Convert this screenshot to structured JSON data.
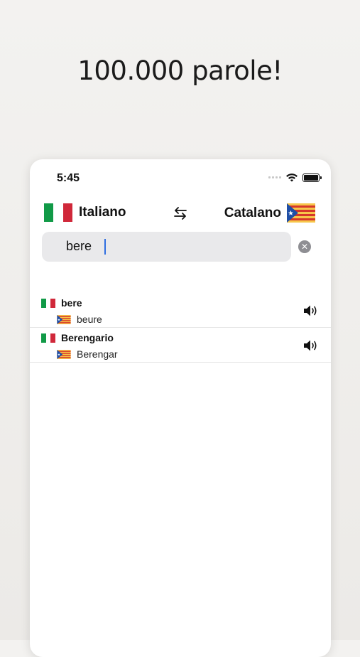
{
  "headline": "100.000 parole!",
  "status": {
    "time": "5:45"
  },
  "languages": {
    "source": "Italiano",
    "target": "Catalano",
    "source_flag": "italy-flag",
    "target_flag": "catalonia-estelada-flag"
  },
  "search": {
    "value": "bere"
  },
  "results": [
    {
      "source": "bere",
      "target": "beure"
    },
    {
      "source": "Berengario",
      "target": "Berengar"
    }
  ],
  "colors": {
    "it_green": "#119a47",
    "it_red": "#d0283a",
    "cat_yellow": "#f7c64a",
    "cat_red": "#d6372a",
    "cat_blue": "#1f4fa6",
    "caret": "#2f6ee0"
  }
}
